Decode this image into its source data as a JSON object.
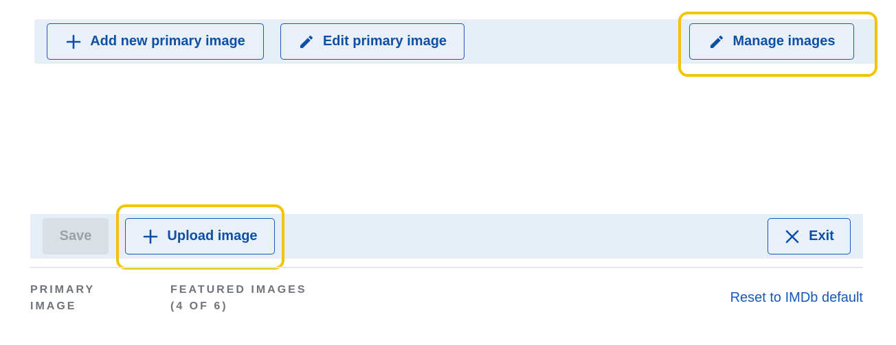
{
  "top_toolbar": {
    "add_primary_label": "Add new primary image",
    "edit_primary_label": "Edit primary image",
    "manage_images_label": "Manage images"
  },
  "bottom_toolbar": {
    "save_label": "Save",
    "upload_label": "Upload image",
    "exit_label": "Exit"
  },
  "sections": {
    "primary_line1": "PRIMARY",
    "primary_line2": "IMAGE",
    "featured_line1": "FEATURED IMAGES",
    "featured_line2": "(4 OF 6)"
  },
  "reset_link": "Reset to IMDb default",
  "colors": {
    "accent": "#1459b9",
    "toolbar_bg": "#e6eef7",
    "highlight": "#f2c500",
    "disabled_bg": "#dadfe5",
    "label_gray": "#6f737a"
  },
  "icons": {
    "add": "plus-icon",
    "edit": "pencil-icon",
    "manage": "pencil-icon",
    "upload": "plus-icon",
    "exit": "close-icon"
  }
}
